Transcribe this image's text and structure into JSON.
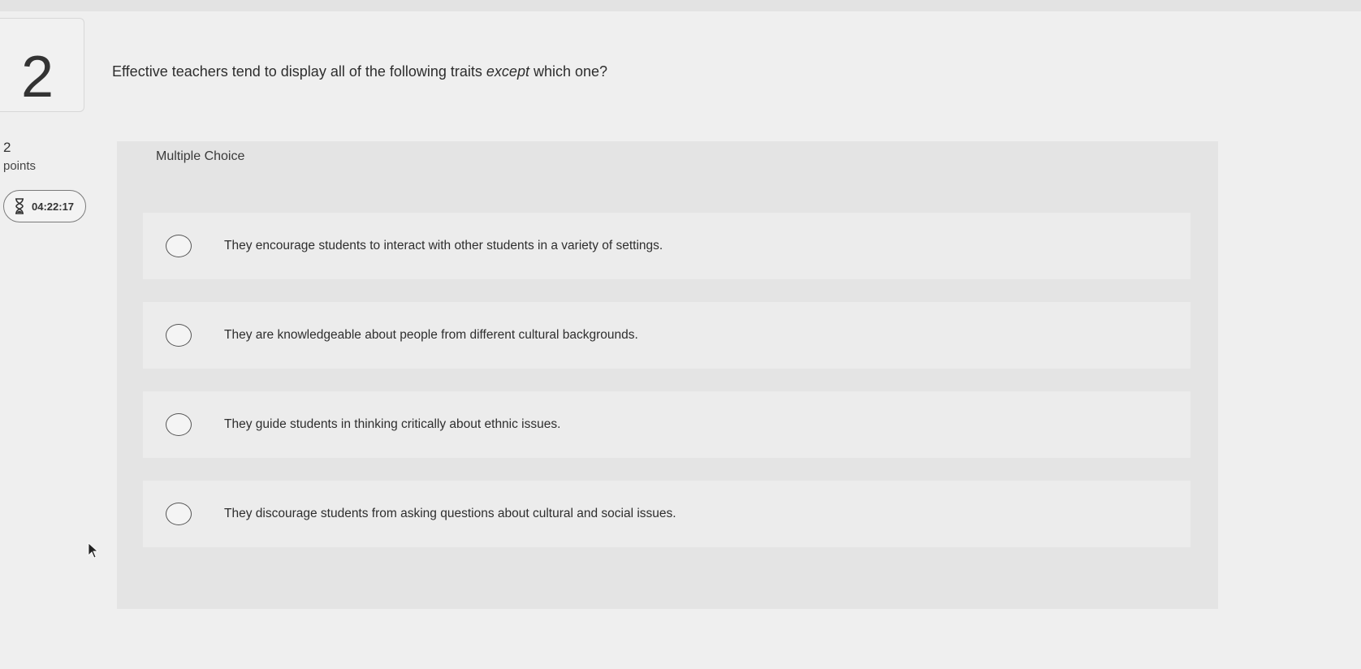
{
  "question": {
    "number": "2",
    "text_before": "Effective teachers tend to display all of the following traits ",
    "text_emphasis": "except",
    "text_after": " which one?"
  },
  "points": {
    "value": "2",
    "label": "points"
  },
  "timer": {
    "icon": "hourglass-icon",
    "time": "04:22:17"
  },
  "answer_type": "Multiple Choice",
  "options": [
    {
      "label": "They encourage students to interact with other students in a variety of settings."
    },
    {
      "label": "They are knowledgeable about people from different cultural backgrounds."
    },
    {
      "label": "They guide students in thinking critically about ethnic issues."
    },
    {
      "label": "They discourage students from asking questions about cultural and social issues."
    }
  ]
}
